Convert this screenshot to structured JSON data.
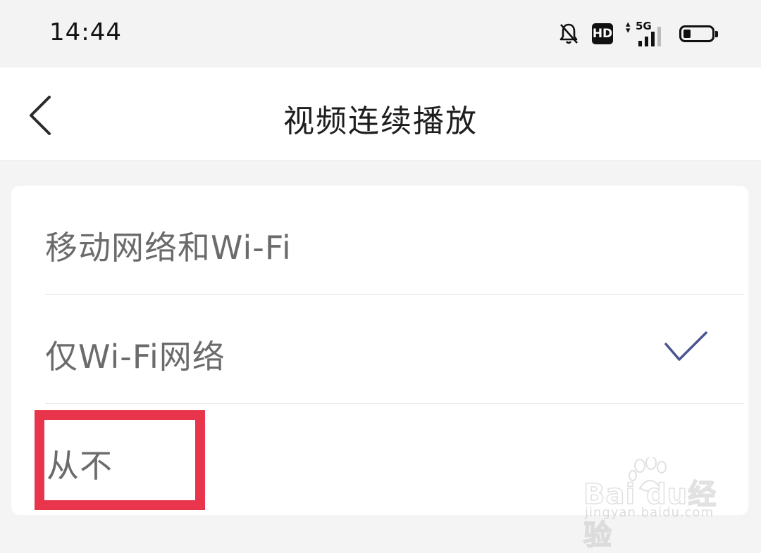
{
  "status_bar": {
    "time": "14:44",
    "icons": [
      "bell-muted-icon",
      "hd-icon",
      "signal-5g-icon",
      "battery-icon"
    ],
    "hd_label": "HD",
    "network_label": "5G",
    "battery_level": 0.25
  },
  "header": {
    "back_icon": "chevron-left-icon",
    "title": "视频连续播放"
  },
  "options": [
    {
      "label": "移动网络和Wi-Fi",
      "selected": false
    },
    {
      "label": "仅Wi-Fi网络",
      "selected": true
    },
    {
      "label": "从不",
      "selected": false,
      "highlighted": true
    }
  ],
  "colors": {
    "check": "#4a5490",
    "highlight": "#e8354b",
    "title": "#1e1e1e",
    "option_text": "#6b6b6b"
  },
  "watermark": {
    "brand": "Bai  du经验",
    "url": "jingyan.baidu.com"
  }
}
